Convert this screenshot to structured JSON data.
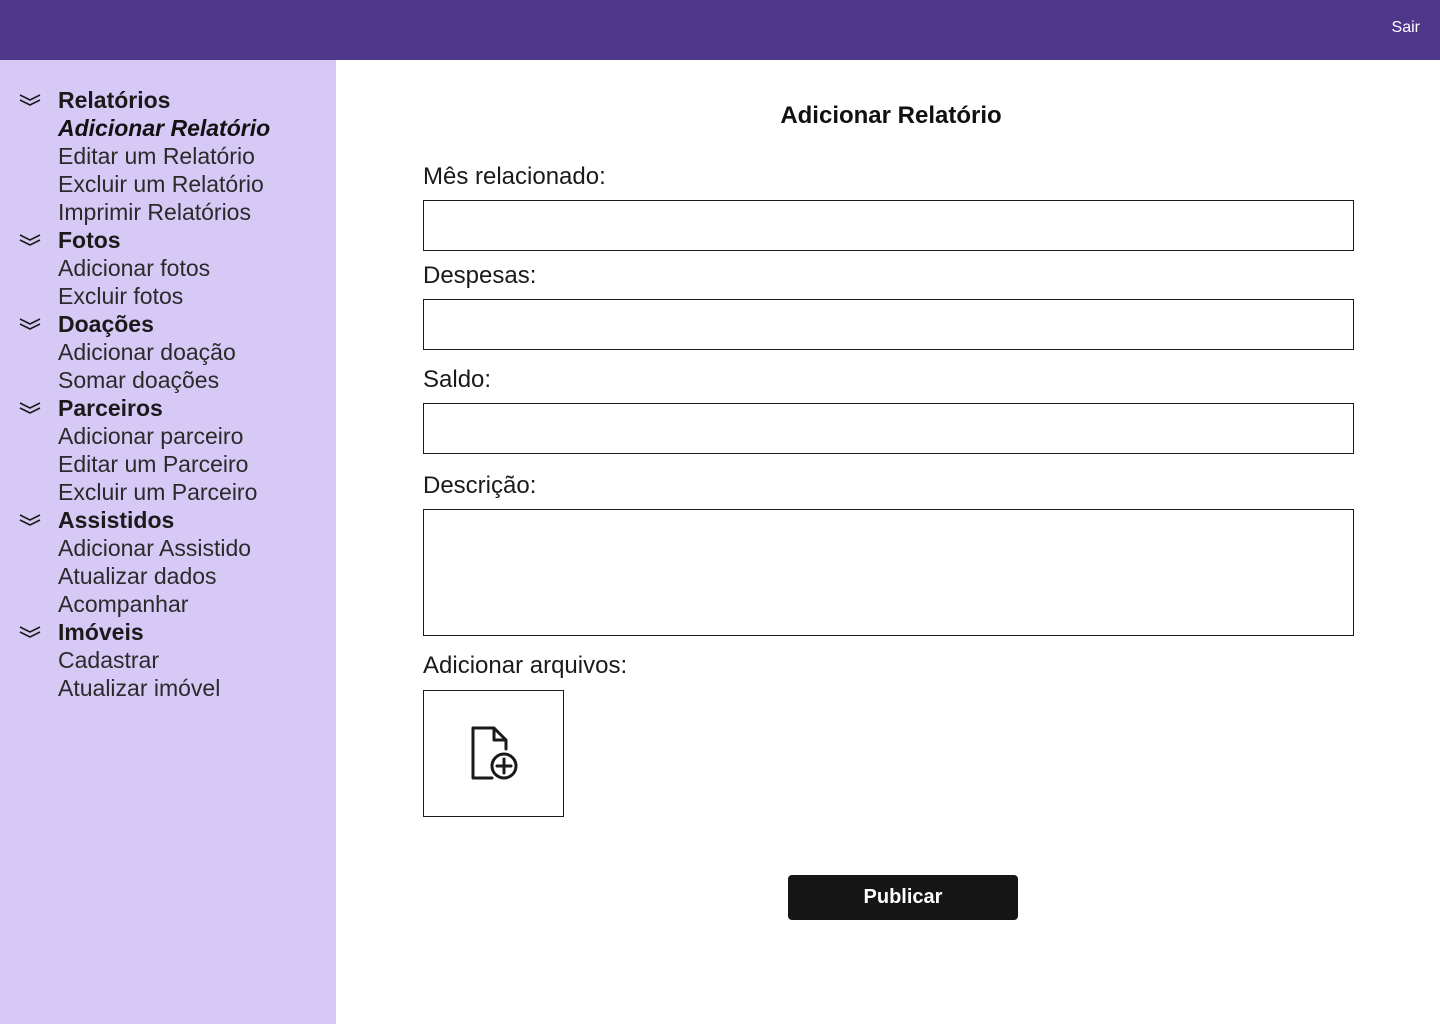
{
  "header": {
    "logout_label": "Sair",
    "bg_color": "#4f378b"
  },
  "sidebar": {
    "bg_color": "#d6c9f6",
    "sections": [
      {
        "title": "Relatórios",
        "icon": "chevron-down-icon",
        "items": [
          "Adicionar Relatório",
          "Editar um Relatório",
          "Excluir um Relatório",
          "Imprimir Relatórios"
        ],
        "active_item": "Adicionar Relatório"
      },
      {
        "title": "Fotos",
        "icon": "chevron-down-icon",
        "items": [
          "Adicionar fotos",
          "Excluir fotos"
        ]
      },
      {
        "title": "Doações",
        "icon": "chevron-down-icon",
        "items": [
          "Adicionar doação",
          "Somar doações"
        ]
      },
      {
        "title": "Parceiros",
        "icon": "chevron-down-icon",
        "items": [
          "Adicionar parceiro",
          "Editar um Parceiro",
          "Excluir um Parceiro"
        ]
      },
      {
        "title": "Assistidos",
        "icon": "chevron-down-icon",
        "items": [
          "Adicionar Assistido",
          "Atualizar dados",
          "Acompanhar"
        ]
      },
      {
        "title": "Imóveis",
        "icon": "chevron-down-icon",
        "items": [
          "Cadastrar",
          "Atualizar imóvel"
        ]
      }
    ]
  },
  "form": {
    "title": "Adicionar Relatório",
    "fields": {
      "month": {
        "label": "Mês relacionado:",
        "value": ""
      },
      "expenses": {
        "label": "Despesas:",
        "value": ""
      },
      "balance": {
        "label": "Saldo:",
        "value": ""
      },
      "description": {
        "label": "Descrição:",
        "value": ""
      }
    },
    "files": {
      "label": "Adicionar arquivos:",
      "icon": "file-add-icon"
    },
    "submit_label": "Publicar",
    "submit_color": "#161616"
  }
}
